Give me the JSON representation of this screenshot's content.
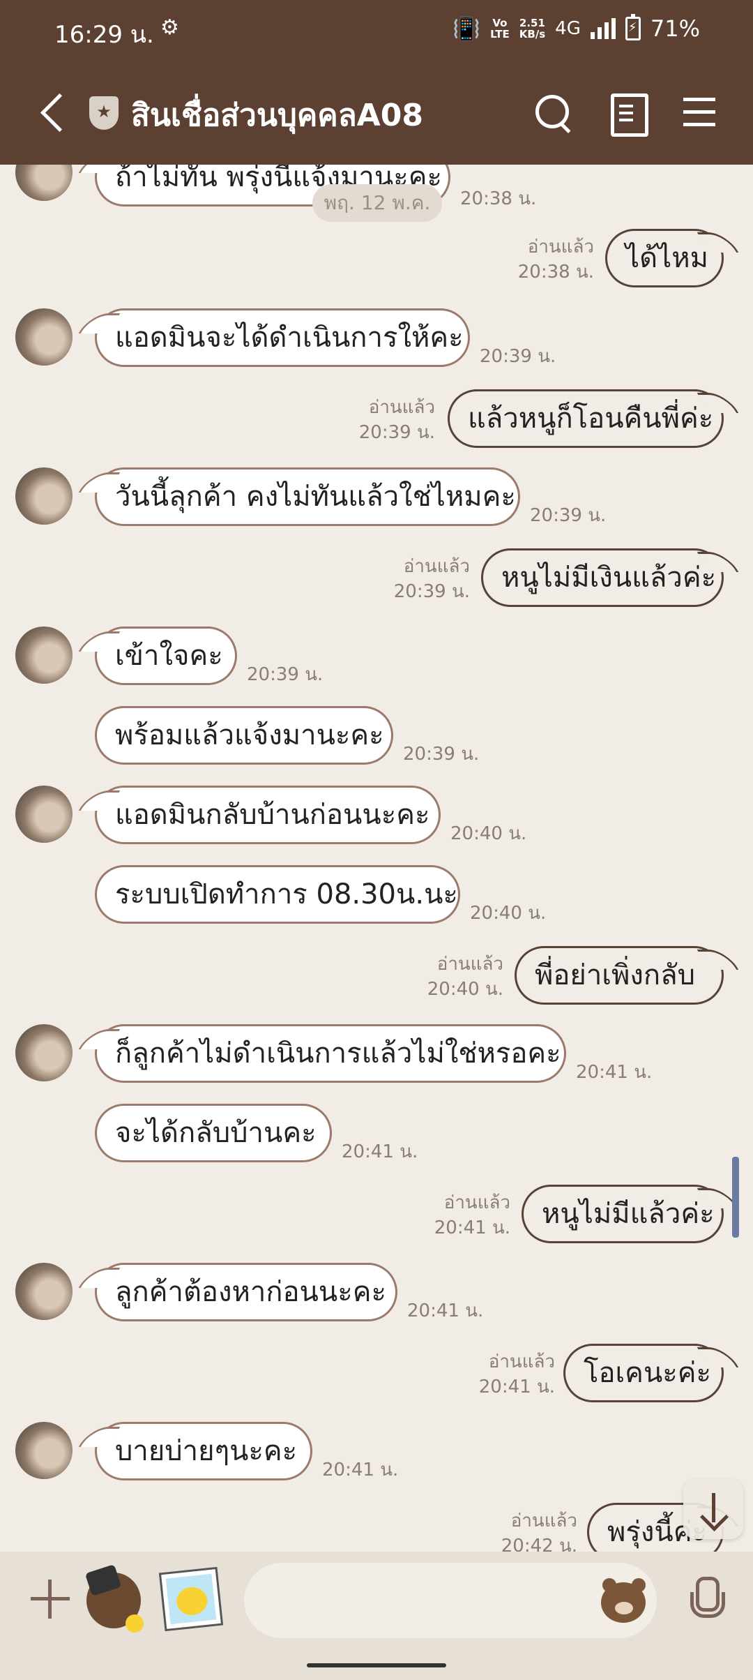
{
  "status_bar": {
    "time": "16:29 น.",
    "net_speed": "2.51",
    "net_unit": "KB/s",
    "network": "4G",
    "battery": "71%"
  },
  "header": {
    "title": "สินเชื่อส่วนบุคคลA08"
  },
  "date_chip": "พฤ. 12 พ.ค.",
  "messages": [
    {
      "dir": "in",
      "text": "ถ้าไม่ทัน พรุ่งนี้แจ้งมานะคะ",
      "time": "20:38 น."
    },
    {
      "dir": "out",
      "text": "ได้ไหม",
      "read": "อ่านแล้ว",
      "time": "20:38 น."
    },
    {
      "dir": "in",
      "text": "แอดมินจะได้ดำเนินการให้คะ",
      "time": "20:39 น."
    },
    {
      "dir": "out",
      "text": "แล้วหนูก็โอนคืนพี่ค่ะ",
      "read": "อ่านแล้ว",
      "time": "20:39 น."
    },
    {
      "dir": "in",
      "text": "วันนี้ลุกค้า คงไม่ทันแล้วใช่ไหมคะ",
      "time": "20:39 น."
    },
    {
      "dir": "out",
      "text": "หนูไม่มีเงินแล้วค่ะ",
      "read": "อ่านแล้ว",
      "time": "20:39 น."
    },
    {
      "dir": "in",
      "text": "เข้าใจคะ",
      "time": "20:39 น."
    },
    {
      "dir": "in",
      "text": "พร้อมแล้วแจ้งมานะคะ",
      "time": "20:39 น."
    },
    {
      "dir": "in",
      "text": "แอดมินกลับบ้านก่อนนะคะ",
      "time": "20:40 น."
    },
    {
      "dir": "in",
      "text": "ระบบเปิดทำการ 08.30น.นะ",
      "time": "20:40 น."
    },
    {
      "dir": "out",
      "text": "พี่อย่าเพิ่งกลับ",
      "read": "อ่านแล้ว",
      "time": "20:40 น."
    },
    {
      "dir": "in",
      "text": "ก็ลูกค้าไม่ดำเนินการแล้วไม่ใช่หรอคะ",
      "time": "20:41 น."
    },
    {
      "dir": "in",
      "text": "จะได้กลับบ้านคะ",
      "time": "20:41 น."
    },
    {
      "dir": "out",
      "text": "หนูไม่มีแล้วค่ะ",
      "read": "อ่านแล้ว",
      "time": "20:41 น."
    },
    {
      "dir": "in",
      "text": "ลูกค้าต้องหาก่อนนะคะ",
      "time": "20:41 น."
    },
    {
      "dir": "out",
      "text": "โอเคนะค่ะ",
      "read": "อ่านแล้ว",
      "time": "20:41 น."
    },
    {
      "dir": "in",
      "text": "บายบ่ายๆนะคะ",
      "time": "20:41 น."
    },
    {
      "dir": "out",
      "text": "พรุ่งนี้ค่ะ",
      "read": "อ่านแล้ว",
      "time": "20:42 น."
    }
  ]
}
